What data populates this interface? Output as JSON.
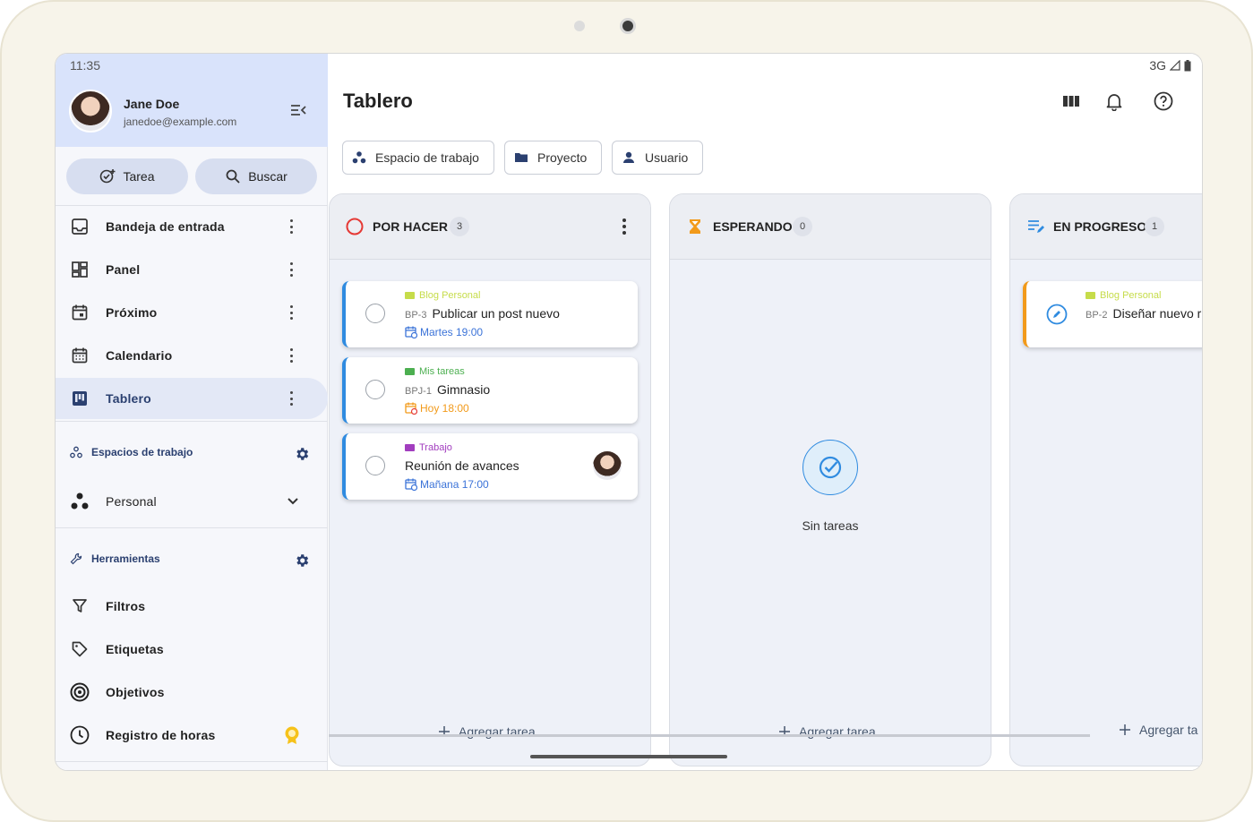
{
  "status": {
    "time": "11:35",
    "network": "3G"
  },
  "user": {
    "name": "Jane Doe",
    "email": "janedoe@example.com"
  },
  "actions": {
    "task_label": "Tarea",
    "search_label": "Buscar"
  },
  "nav": [
    {
      "label": "Bandeja de entrada",
      "icon": "inbox-icon"
    },
    {
      "label": "Panel",
      "icon": "dashboard-icon"
    },
    {
      "label": "Próximo",
      "icon": "upcoming-icon"
    },
    {
      "label": "Calendario",
      "icon": "calendar-icon"
    },
    {
      "label": "Tablero",
      "icon": "board-icon",
      "active": true
    }
  ],
  "workspaces": {
    "heading": "Espacios de trabajo",
    "current": "Personal"
  },
  "tools": {
    "heading": "Herramientas",
    "items": [
      {
        "label": "Filtros",
        "icon": "filter-icon"
      },
      {
        "label": "Etiquetas",
        "icon": "tag-icon"
      },
      {
        "label": "Objetivos",
        "icon": "target-icon"
      },
      {
        "label": "Registro de horas",
        "icon": "clock-icon"
      }
    ]
  },
  "page": {
    "title": "Tablero"
  },
  "filters": {
    "workspace": "Espacio de trabajo",
    "project": "Proyecto",
    "user": "Usuario"
  },
  "columns": [
    {
      "title": "POR HACER",
      "count": "3",
      "icon": "circle-icon",
      "cards": [
        {
          "project": "Blog Personal",
          "project_color": "#c6dc4a",
          "key": "BP-3",
          "title": "Publicar un post nuevo",
          "due": "Martes 19:00",
          "due_color": "#3b73d8",
          "accent": "blue"
        },
        {
          "project": "Mis tareas",
          "project_color": "#4caf50",
          "key": "BPJ-1",
          "title": "Gimnasio",
          "due": "Hoy 18:00",
          "due_color": "#f29a1a",
          "accent": "blue"
        },
        {
          "project": "Trabajo",
          "project_color": "#a23ebf",
          "key": "",
          "title": "Reunión de avances",
          "due": "Mañana 17:00",
          "due_color": "#3b73d8",
          "accent": "blue"
        }
      ],
      "add_label": "Agregar tarea"
    },
    {
      "title": "ESPERANDO",
      "count": "0",
      "icon": "hourglass-icon",
      "empty_text": "Sin tareas",
      "add_label": "Agregar tarea"
    },
    {
      "title": "EN PROGRESO",
      "count": "1",
      "icon": "progress-icon",
      "cards": [
        {
          "project": "Blog Personal",
          "project_color": "#c6dc4a",
          "key": "BP-2",
          "title": "Diseñar nuevo r",
          "accent": "orange"
        }
      ],
      "add_label": "Agregar ta"
    }
  ],
  "colors": {
    "accent": "#2f8be0",
    "sidebar_header": "#d9e3fb",
    "warning": "#f29a1a",
    "danger": "#e53935"
  }
}
